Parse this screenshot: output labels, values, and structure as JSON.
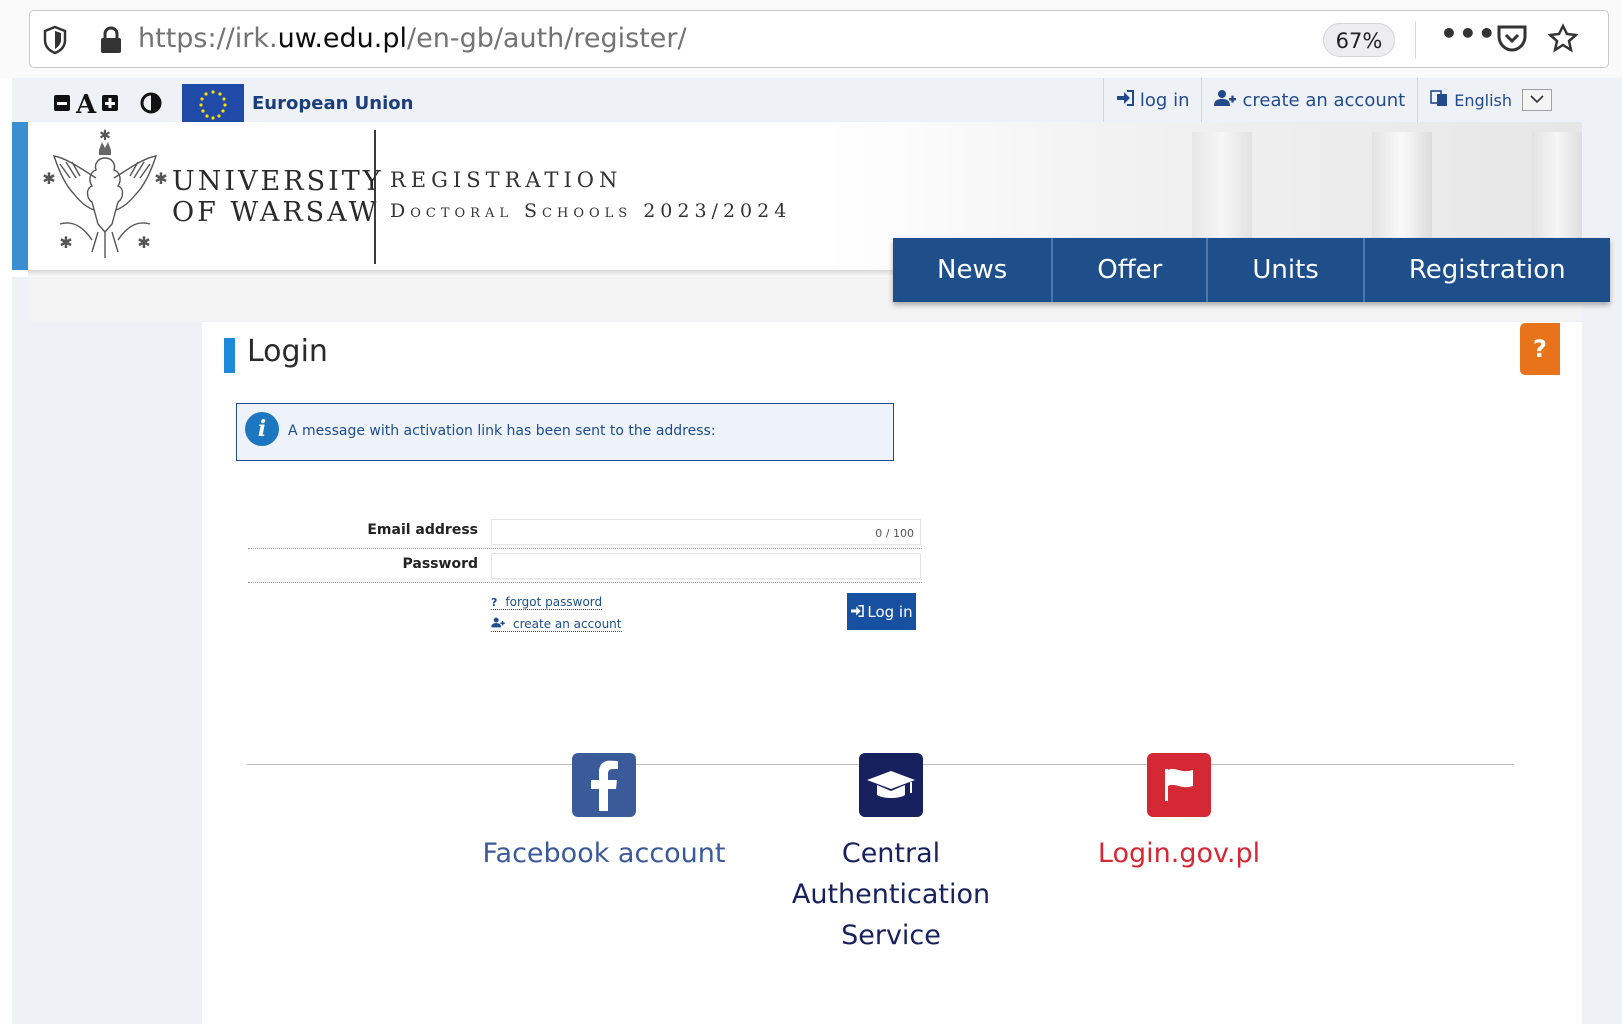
{
  "browser": {
    "url_prefix": "https://irk.",
    "url_domain": "uw.edu.pl",
    "url_path": "/en-gb/auth/register/",
    "zoom": "67%",
    "more_label": "•••"
  },
  "topbar": {
    "eu_label": "European Union",
    "log_in": "log in",
    "create_account": "create an account",
    "language": "English"
  },
  "header": {
    "uni_line1": "UNIVERSITY",
    "uni_line2": "OF WARSAW",
    "reg_line1": "REGISTRATION",
    "reg_line2": "Doctoral Schools 2023/2024"
  },
  "nav": {
    "items": [
      {
        "label": "News"
      },
      {
        "label": "Offer"
      },
      {
        "label": "Units"
      },
      {
        "label": "Registration"
      }
    ]
  },
  "page": {
    "title": "Login",
    "info_message": "A message with activation link has been sent to the address:"
  },
  "form": {
    "email_label": "Email address",
    "email_value": "",
    "email_counter": "0 / 100",
    "password_label": "Password",
    "password_value": "",
    "forgot_password": "forgot password",
    "create_account": "create an account",
    "login_button": "Log in"
  },
  "providers": [
    {
      "label": "Facebook account",
      "color": "#3b5a9a"
    },
    {
      "label": "Central Authentication Service",
      "color": "#17215e"
    },
    {
      "label": "Login.gov.pl",
      "color": "#d42935"
    }
  ],
  "help_label": "?",
  "colors": {
    "nav_bg": "#1e4f8a",
    "accent_blue": "#1d89d8",
    "login_button": "#1750a0",
    "help": "#e8731a"
  }
}
